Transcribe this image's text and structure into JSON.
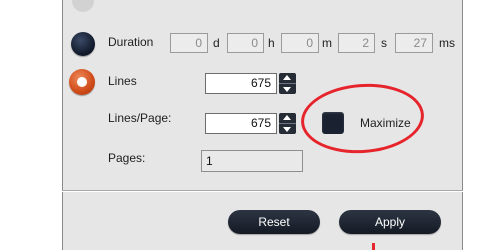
{
  "duration": {
    "label": "Duration",
    "fields": [
      {
        "value": "0",
        "unit": "d"
      },
      {
        "value": "0",
        "unit": "h"
      },
      {
        "value": "0",
        "unit": "m"
      },
      {
        "value": "2",
        "unit": "s"
      },
      {
        "value": "27",
        "unit": "ms"
      }
    ]
  },
  "lines": {
    "label": "Lines",
    "value": "675"
  },
  "lines_per_page": {
    "label": "Lines/Page:",
    "value": "675"
  },
  "maximize": {
    "label": "Maximize"
  },
  "pages": {
    "label": "Pages:",
    "value": "1"
  },
  "buttons": {
    "reset": "Reset",
    "apply": "Apply"
  },
  "colors": {
    "panel": "#e6e6e6",
    "dark_control": "#1a2130",
    "selected_radio": "#cf4a18",
    "annotation": "#e6242b"
  },
  "icons": {
    "spinner_up": "triangle-up-icon",
    "spinner_down": "triangle-down-icon"
  }
}
